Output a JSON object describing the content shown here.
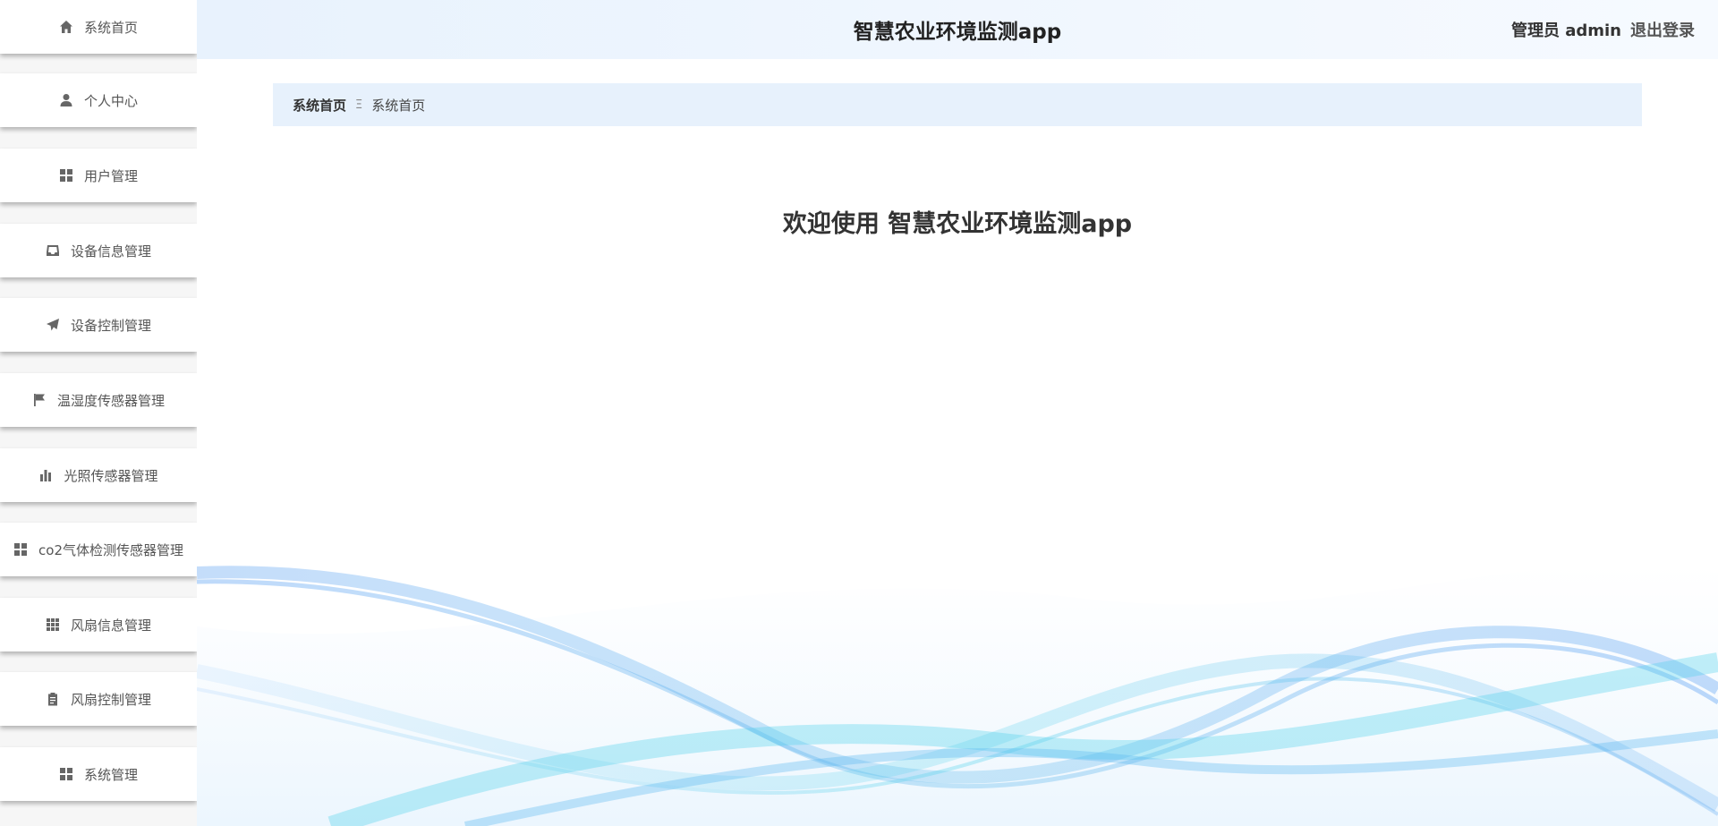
{
  "app": {
    "title": "智慧农业环境监测app"
  },
  "header": {
    "admin_label": "管理员 admin",
    "logout_label": "退出登录"
  },
  "sidebar": {
    "items": [
      {
        "label": "系统首页",
        "icon": "home-icon"
      },
      {
        "label": "个人中心",
        "icon": "user-icon"
      },
      {
        "label": "用户管理",
        "icon": "grid-icon"
      },
      {
        "label": "设备信息管理",
        "icon": "inbox-icon"
      },
      {
        "label": "设备控制管理",
        "icon": "paper-plane-icon"
      },
      {
        "label": "温湿度传感器管理",
        "icon": "flag-icon"
      },
      {
        "label": "光照传感器管理",
        "icon": "bar-chart-icon"
      },
      {
        "label": "co2气体检测传感器管理",
        "icon": "grid-icon"
      },
      {
        "label": "风扇信息管理",
        "icon": "grid-3x3-icon"
      },
      {
        "label": "风扇控制管理",
        "icon": "clipboard-icon"
      },
      {
        "label": "系统管理",
        "icon": "grid-icon"
      }
    ]
  },
  "breadcrumb": {
    "first": "系统首页",
    "separator": "Ξ",
    "second": "系统首页"
  },
  "main": {
    "welcome": "欢迎使用 智慧农业环境监测app"
  },
  "colors": {
    "header_bg": "#e8f2fd",
    "breadcrumb_bg": "#e7f1fc",
    "wave_blue": "#3b8df0",
    "wave_cyan": "#4fd1ea"
  }
}
